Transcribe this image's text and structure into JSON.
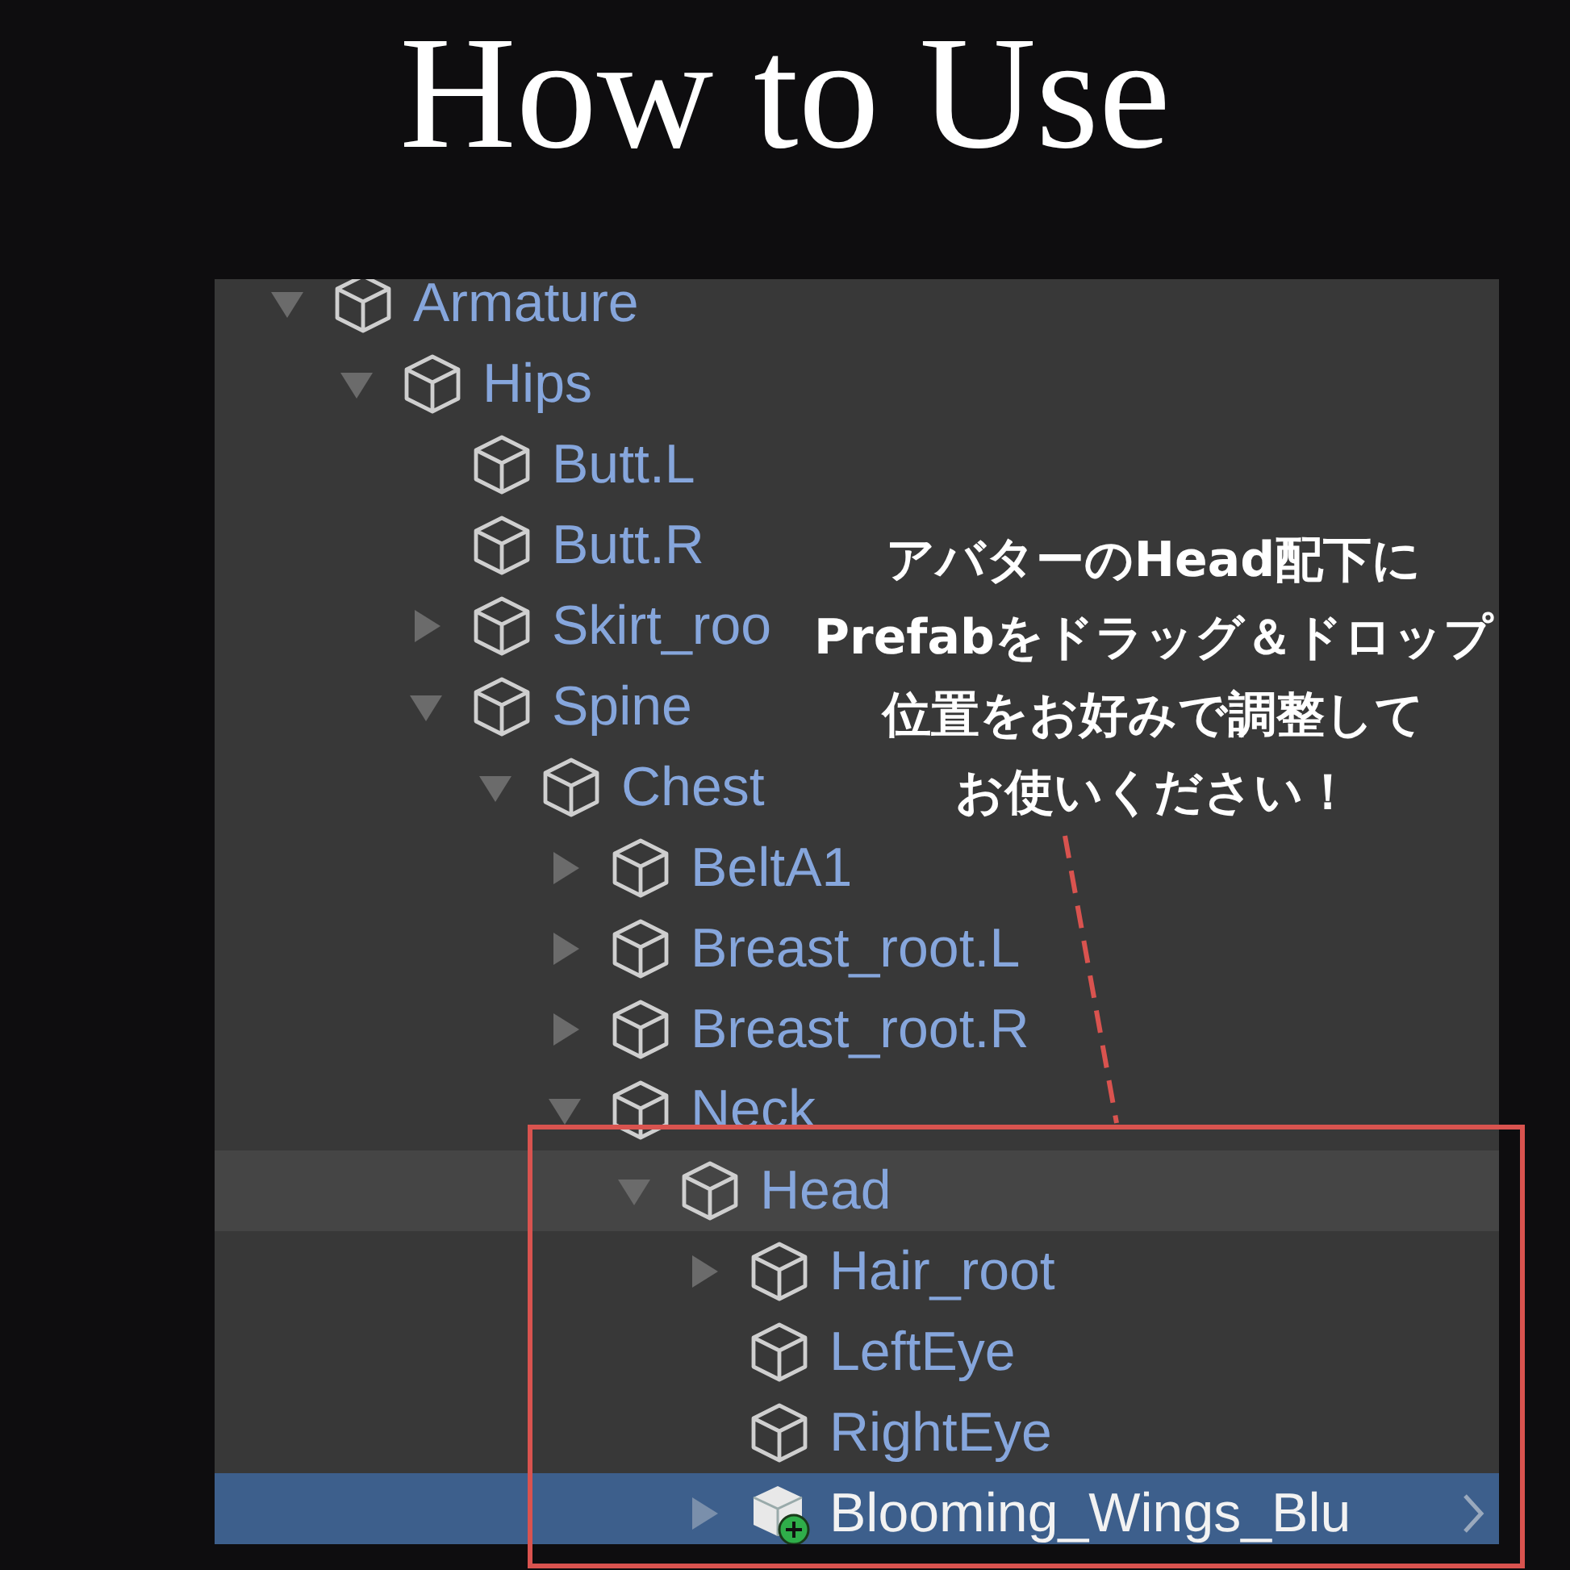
{
  "title": "How to Use",
  "hierarchy": {
    "nodes": [
      {
        "name": "Armature",
        "kind": "object",
        "expanded": true,
        "hovered": false,
        "selected": false,
        "children": [
          {
            "name": "Hips",
            "kind": "object",
            "expanded": true,
            "hovered": false,
            "selected": false,
            "children": [
              {
                "name": "Butt.L",
                "kind": "object",
                "hovered": false,
                "selected": false
              },
              {
                "name": "Butt.R",
                "kind": "object",
                "hovered": false,
                "selected": false
              },
              {
                "name": "Skirt_roo",
                "kind": "object",
                "expanded": false,
                "hovered": false,
                "selected": false
              },
              {
                "name": "Spine",
                "kind": "object",
                "expanded": true,
                "hovered": false,
                "selected": false,
                "children": [
                  {
                    "name": "Chest",
                    "kind": "object",
                    "expanded": true,
                    "hovered": false,
                    "selected": false,
                    "children": [
                      {
                        "name": "BeltA1",
                        "kind": "object",
                        "expanded": false,
                        "hovered": false,
                        "selected": false
                      },
                      {
                        "name": "Breast_root.L",
                        "kind": "object",
                        "expanded": false,
                        "hovered": false,
                        "selected": false
                      },
                      {
                        "name": "Breast_root.R",
                        "kind": "object",
                        "expanded": false,
                        "hovered": false,
                        "selected": false
                      },
                      {
                        "name": "Neck",
                        "kind": "object",
                        "expanded": true,
                        "hovered": false,
                        "selected": false,
                        "children": [
                          {
                            "name": "Head",
                            "kind": "object",
                            "expanded": true,
                            "hovered": true,
                            "selected": false,
                            "children": [
                              {
                                "name": "Hair_root",
                                "kind": "object",
                                "expanded": false,
                                "hovered": false,
                                "selected": false
                              },
                              {
                                "name": "LeftEye",
                                "kind": "object",
                                "hovered": false,
                                "selected": false
                              },
                              {
                                "name": "RightEye",
                                "kind": "object",
                                "hovered": false,
                                "selected": false
                              },
                              {
                                "name": "Blooming_Wings_Blu",
                                "kind": "prefab",
                                "expanded": false,
                                "hovered": false,
                                "selected": true,
                                "has_overrides_arrow": true
                              }
                            ]
                          }
                        ]
                      }
                    ]
                  }
                ]
              }
            ]
          }
        ]
      }
    ]
  },
  "instruction_lines": [
    "アバターのHead配下に",
    "Prefabをドラッグ＆ドロップ",
    "位置をお好みで調整して",
    "お使いください！"
  ]
}
